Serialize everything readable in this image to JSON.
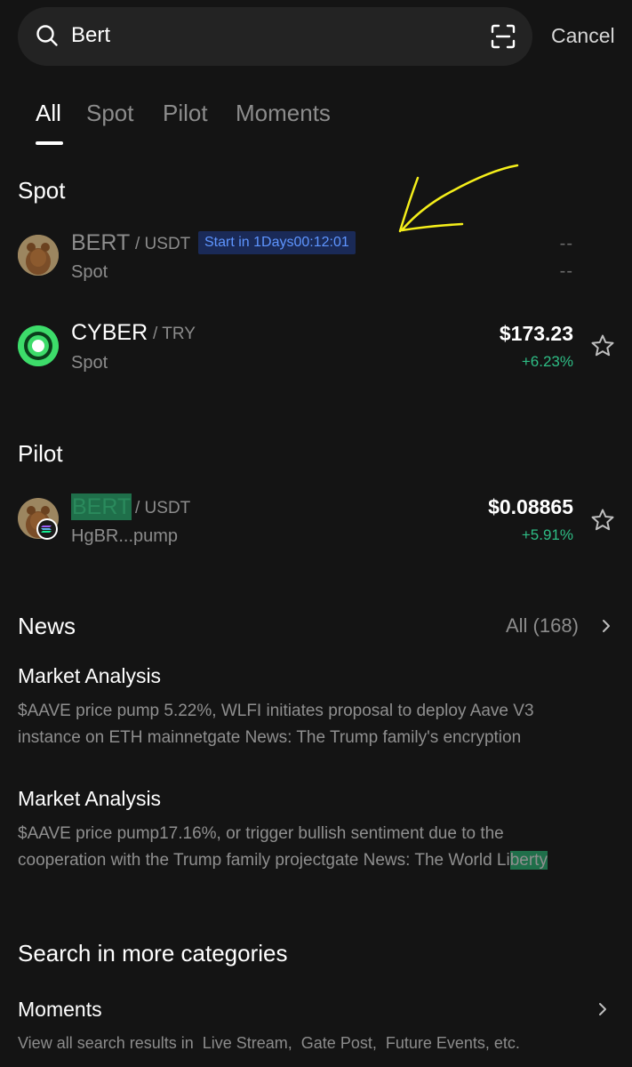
{
  "search": {
    "query": "Bert",
    "cancel_label": "Cancel"
  },
  "tabs": [
    {
      "label": "All",
      "active": true
    },
    {
      "label": "Spot",
      "active": false
    },
    {
      "label": "Pilot",
      "active": false
    },
    {
      "label": "Moments",
      "active": false
    }
  ],
  "spot": {
    "title": "Spot",
    "items": [
      {
        "base": "BERT",
        "quote": "/ USDT",
        "badge": "Start in 1Days00:12:01",
        "sub": "Spot",
        "price": "--",
        "change": "--"
      },
      {
        "base": "CYBER",
        "quote": "/ TRY",
        "sub": "Spot",
        "price": "$173.23",
        "change": "+6.23%"
      }
    ]
  },
  "pilot": {
    "title": "Pilot",
    "items": [
      {
        "base": "BERT",
        "quote": "/ USDT",
        "sub": "HgBR...pump",
        "price": "$0.08865",
        "change": "+5.91%"
      }
    ]
  },
  "news": {
    "title": "News",
    "all_label": "All (168)",
    "items": [
      {
        "title": "Market Analysis",
        "line1": "$AAVE price pump 5.22%, WLFI initiates proposal to deploy Aave V3",
        "line2": "instance on ETH mainnetgate News: The Trump family's encryption"
      },
      {
        "title": "Market Analysis",
        "line1": "$AAVE price pump17.16%, or trigger bullish sentiment due to the",
        "line2_pre": "cooperation with the Trump family projectgate News: The World Li",
        "line2_hl": "berty"
      }
    ]
  },
  "more": {
    "title": "Search in more categories",
    "item_title": "Moments",
    "item_desc": "View all search results in  Live Stream,  Gate Post,  Future Events, etc."
  },
  "colors": {
    "background": "#141414",
    "positive": "#2ebd85",
    "badge_bg": "#1a2a57",
    "badge_text": "#5e95ff",
    "annotation": "#f5ef1a"
  },
  "icons": [
    "search-icon",
    "scan-icon",
    "star-icon",
    "chevron-right-icon",
    "solana-icon"
  ]
}
